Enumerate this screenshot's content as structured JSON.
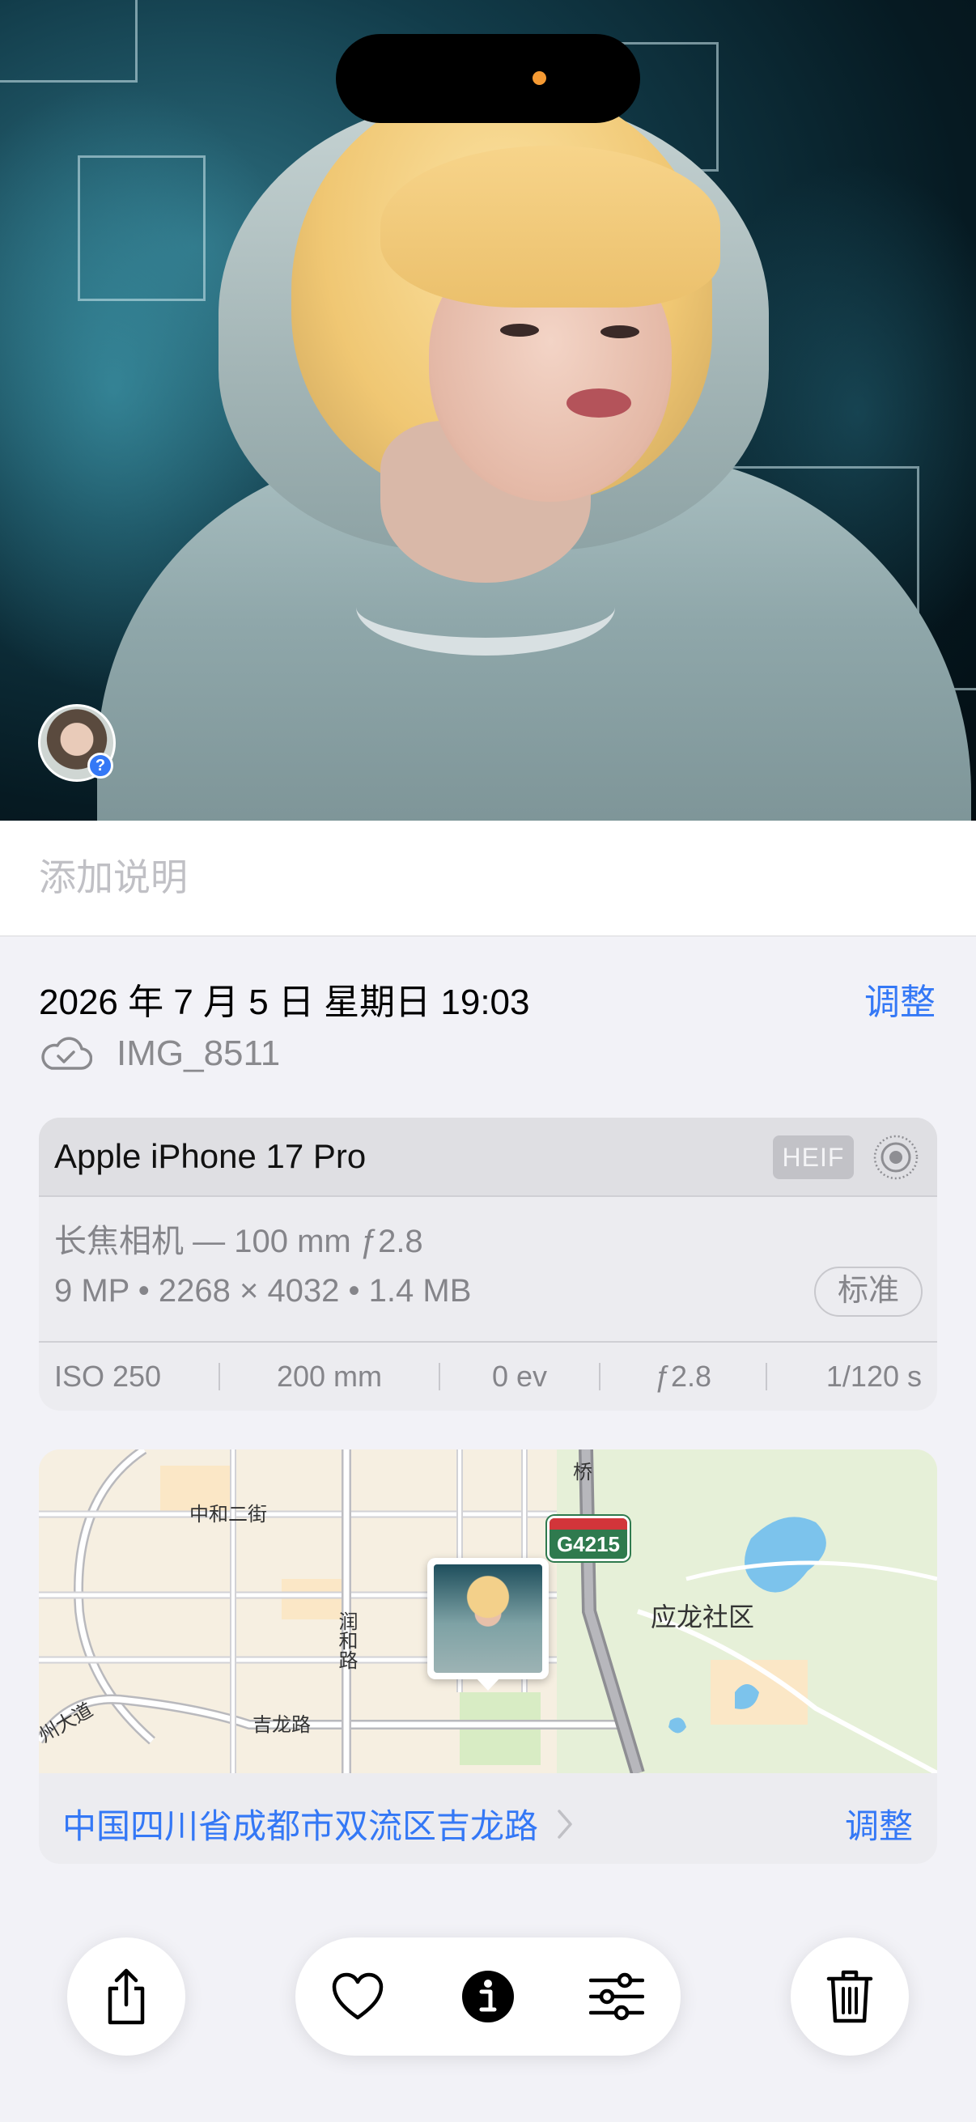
{
  "caption": {
    "placeholder": "添加说明"
  },
  "info": {
    "datetime": "2026 年 7 月 5 日 星期日 19:03",
    "adjust_label": "调整",
    "filename": "IMG_8511",
    "cloud_icon": "cloud-check-icon"
  },
  "device_card": {
    "device": "Apple iPhone 17 Pro",
    "format_badge": "HEIF",
    "live_icon": "live-photo-icon",
    "lens": "长焦相机 — 100 mm ƒ2.8",
    "specs": "9 MP • 2268 × 4032 • 1.4 MB",
    "style_pill": "标准",
    "exif": [
      "ISO 250",
      "200 mm",
      "0 ev",
      "ƒ2.8",
      "1/120 s"
    ]
  },
  "map": {
    "labels": {
      "street_1": "中和二街",
      "street_2": "润和路",
      "street_3": "吉龙路",
      "street_4": "州大道",
      "street_5": "桥",
      "district": "应龙社区"
    },
    "highway_shield": "G4215",
    "location": "中国四川省成都市双流区吉龙路",
    "adjust_label": "调整"
  },
  "toolbar": {
    "share_icon": "share-icon",
    "favorite_icon": "heart-icon",
    "info_icon": "info-icon",
    "edit_icon": "sliders-icon",
    "delete_icon": "trash-icon"
  },
  "colors": {
    "accent": "#3478f6",
    "secondary_text": "#85858a",
    "background": "#f2f2f7"
  }
}
